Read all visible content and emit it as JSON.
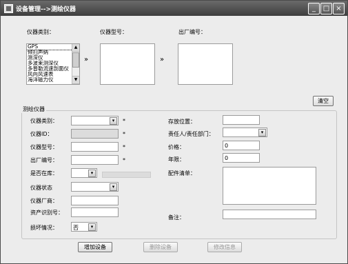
{
  "window": {
    "title": "设备管理-->测绘仪器",
    "minimize": "_",
    "maximize": "□",
    "close": "×"
  },
  "top": {
    "category_label": "仪器类别：",
    "model_label": "仪器型号：",
    "serial_label": "出厂编号：",
    "arrow1": "»",
    "arrow2": "»",
    "category_items": [
      "GPS",
      "倾扫声纳",
      "测深仪",
      "多波束测深仪",
      "多普勒流速剖面仪",
      "风向风速表",
      "海洋磁力仪"
    ],
    "clear_button": "清空"
  },
  "form": {
    "group_title": "测绘仪器",
    "category": {
      "label": "仪器类别：",
      "value": "",
      "required": "*"
    },
    "instrument_id": {
      "label": "仪器ID：",
      "value": "",
      "required": "*"
    },
    "model": {
      "label": "仪器型号：",
      "value": "",
      "required": "*"
    },
    "serial": {
      "label": "出厂编号：",
      "value": "",
      "required": "*"
    },
    "in_stock": {
      "label": "是否在库：",
      "value": ""
    },
    "status": {
      "label": "仪器状态",
      "value": ""
    },
    "manufacturer": {
      "label": "仪器厂商：",
      "value": ""
    },
    "asset_id": {
      "label": "资产识别号：",
      "value": ""
    },
    "damage": {
      "label": "损坏情况：",
      "value": "否"
    },
    "location": {
      "label": "存放位置：",
      "value": ""
    },
    "responsible": {
      "label": "责任人/责任部门：",
      "value": ""
    },
    "price": {
      "label": "价格：",
      "value": "0"
    },
    "years": {
      "label": "年限：",
      "value": "0"
    },
    "parts": {
      "label": "配件清单：",
      "value": ""
    },
    "remarks": {
      "label": "备注：",
      "value": ""
    }
  },
  "buttons": {
    "add": "增加设备",
    "delete": "删除设备",
    "modify": "修改信息"
  },
  "icons": {
    "dropdown": "▾"
  }
}
